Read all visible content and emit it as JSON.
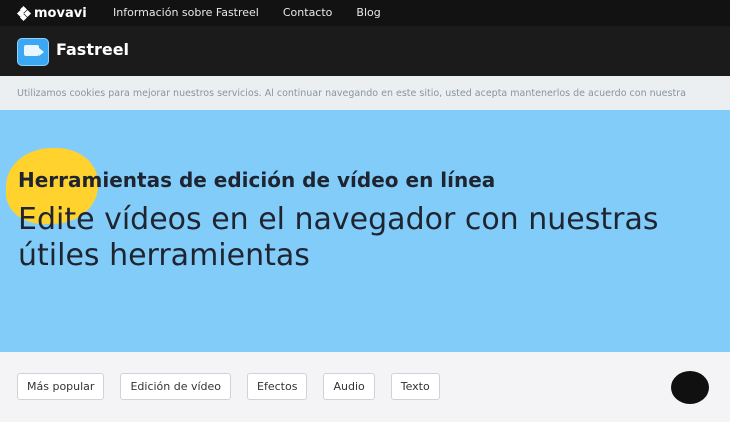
{
  "topbar": {
    "brand": "movavi",
    "nav": [
      "Información sobre Fastreel",
      "Contacto",
      "Blog"
    ]
  },
  "appbar": {
    "app_icon": "video-editor-icon",
    "app_name": "Fastreel"
  },
  "cookie_notice": "Utilizamos cookies para mejorar nuestros servicios. Al continuar navegando en este sitio, usted acepta mantenerlos de acuerdo con nuestra",
  "hero": {
    "title": "Herramientas de edición de vídeo en línea",
    "subtitle": "Edite vídeos en el navegador con nuestras útiles herramientas"
  },
  "filters": [
    "Más popular",
    "Edición de vídeo",
    "Efectos",
    "Audio",
    "Texto"
  ],
  "chat_icon": "chat-bubble-icon",
  "colors": {
    "topbar": "#121212",
    "appbar": "#1b1b1b",
    "hero_bg": "#82ccfa",
    "accent_blob": "#ffd22e"
  }
}
